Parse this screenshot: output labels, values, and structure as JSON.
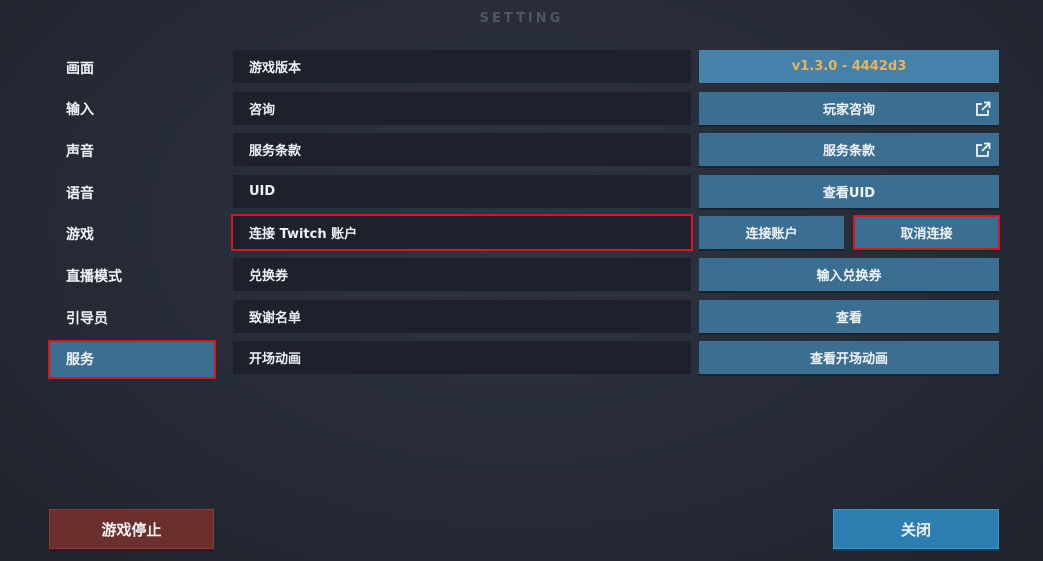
{
  "title": "SETTING",
  "sidebar": {
    "items": [
      {
        "label": "画面"
      },
      {
        "label": "输入"
      },
      {
        "label": "声音"
      },
      {
        "label": "语音"
      },
      {
        "label": "游戏"
      },
      {
        "label": "直播模式"
      },
      {
        "label": "引导员"
      },
      {
        "label": "服务"
      }
    ],
    "active": "服务"
  },
  "rows": {
    "version": {
      "label": "游戏版本",
      "value": "v1.3.0 - 4442d3"
    },
    "inquiry": {
      "label": "咨询",
      "button": "玩家咨询",
      "icon": "external-link-icon"
    },
    "terms": {
      "label": "服务条款",
      "button": "服务条款",
      "icon": "external-link-icon"
    },
    "uid": {
      "label": "UID",
      "button": "查看UID"
    },
    "twitch": {
      "label": "连接 Twitch 账户",
      "connect": "连接账户",
      "disconnect": "取消连接"
    },
    "coupon": {
      "label": "兑换券",
      "button": "输入兑换券"
    },
    "credits": {
      "label": "致谢名单",
      "button": "查看"
    },
    "opening": {
      "label": "开场动画",
      "button": "查看开场动画"
    }
  },
  "footer": {
    "stop_label": "游戏停止",
    "close_label": "关闭"
  },
  "colors": {
    "accent": "#3a6e93",
    "highlight": "#e0121e",
    "version_text": "#e9b35a"
  }
}
